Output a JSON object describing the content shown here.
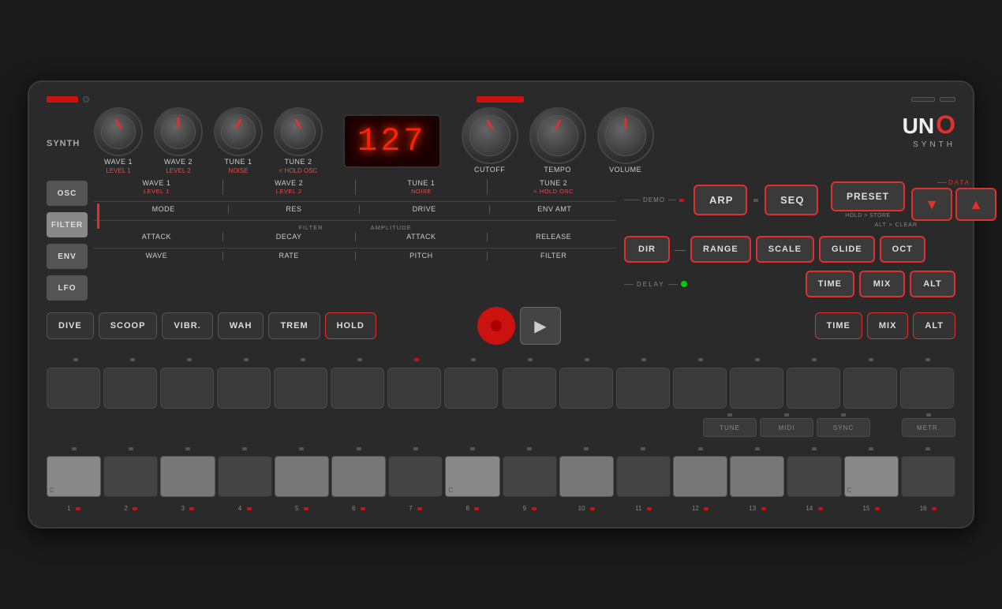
{
  "synth": {
    "title": "SYNTH",
    "logo": {
      "uno": "UNO",
      "synth": "SYNTH"
    },
    "display_value": "127",
    "knobs": {
      "top_left": [
        {
          "label": "WAVE 1",
          "sublabel": "LEVEL 1"
        },
        {
          "label": "WAVE 2",
          "sublabel": "LEVEL 2"
        },
        {
          "label": "TUNE 1",
          "sublabel": "NOISE"
        },
        {
          "label": "TUNE 2",
          "sublabel": "< HOLD OSC"
        }
      ],
      "top_right": [
        {
          "label": "CUTOFF"
        },
        {
          "label": "TEMPO"
        },
        {
          "label": "VOLUME"
        }
      ]
    },
    "mode_buttons": [
      {
        "label": "OSC"
      },
      {
        "label": "FILTER"
      },
      {
        "label": "ENV"
      },
      {
        "label": "LFO"
      }
    ],
    "param_rows": {
      "osc": [
        {
          "name": "WAVE 1",
          "sub": "LEVEL 1"
        },
        {
          "name": "WAVE 2",
          "sub": "LEVEL 2"
        },
        {
          "name": "TUNE 1",
          "sub": "NOISE"
        },
        {
          "name": "TUNE 2",
          "sub": "< HOLD OSC"
        }
      ],
      "filter": [
        {
          "name": "MODE"
        },
        {
          "name": "RES"
        },
        {
          "name": "DRIVE"
        },
        {
          "name": "ENV AMT"
        }
      ],
      "filter_labels": {
        "left": "FILTER",
        "right": "AMPLITUDE"
      },
      "env": [
        {
          "name": "ATTACK"
        },
        {
          "name": "DECAY"
        },
        {
          "name": "ATTACK"
        },
        {
          "name": "RELEASE"
        }
      ],
      "lfo": [
        {
          "name": "WAVE"
        },
        {
          "name": "RATE"
        },
        {
          "name": "PITCH"
        },
        {
          "name": "FILTER"
        }
      ]
    },
    "arp_seq": {
      "demo_label": "DEMO",
      "arp_label": "ARP",
      "seq_label": "SEQ"
    },
    "buttons": {
      "preset": "PRESET",
      "preset_sub1": "HOLD > STORE",
      "preset_sub2": "ALT > CLEAR",
      "data_label": "DATA",
      "data_down": "▼",
      "data_up": "▲",
      "dir": "DIR",
      "range": "RANGE",
      "scale": "SCALE",
      "glide": "GLIDE",
      "oct": "OCT",
      "delay_label": "DELAY",
      "time": "TIME",
      "mix": "MIX",
      "alt": "ALT"
    },
    "bottom_buttons": [
      {
        "label": "DIVE"
      },
      {
        "label": "SCOOP"
      },
      {
        "label": "VIBR."
      },
      {
        "label": "WAH"
      },
      {
        "label": "TREM"
      },
      {
        "label": "HOLD"
      }
    ],
    "step_numbers": [
      "1",
      "2",
      "3",
      "4",
      "5",
      "6",
      "7",
      "8",
      "9",
      "10",
      "11",
      "12",
      "13",
      "14",
      "15",
      "16"
    ],
    "util_buttons": [
      "TUNE",
      "MIDI",
      "SYNC",
      "METR."
    ],
    "piano_keys": [
      {
        "note": "C",
        "number": "1",
        "type": "white"
      },
      {
        "note": "",
        "number": "2",
        "type": "black"
      },
      {
        "note": "",
        "number": "3",
        "type": "white"
      },
      {
        "note": "",
        "number": "4",
        "type": "black"
      },
      {
        "note": "",
        "number": "5",
        "type": "white"
      },
      {
        "note": "",
        "number": "6",
        "type": "white"
      },
      {
        "note": "",
        "number": "7",
        "type": "black"
      },
      {
        "note": "C",
        "number": "8",
        "type": "white"
      },
      {
        "note": "",
        "number": "9",
        "type": "black"
      },
      {
        "note": "",
        "number": "10",
        "type": "white"
      },
      {
        "note": "",
        "number": "11",
        "type": "black"
      },
      {
        "note": "",
        "number": "12",
        "type": "white"
      },
      {
        "note": "",
        "number": "13",
        "type": "white"
      },
      {
        "note": "",
        "number": "14",
        "type": "black"
      },
      {
        "note": "C",
        "number": "15",
        "type": "white"
      },
      {
        "note": "",
        "number": "16",
        "type": "black"
      }
    ]
  }
}
